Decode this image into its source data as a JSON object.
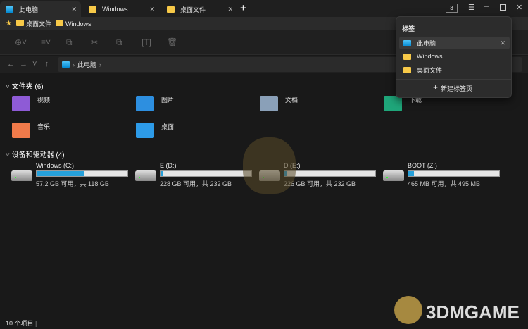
{
  "tabs": [
    {
      "label": "此电脑",
      "icon": "monitor-icon"
    },
    {
      "label": "Windows",
      "icon": "folder-icon"
    },
    {
      "label": "桌面文件",
      "icon": "folder-icon"
    }
  ],
  "window": {
    "tab_count": "3"
  },
  "bookmarks": [
    "桌面文件",
    "Windows"
  ],
  "address": {
    "path": "此电脑"
  },
  "folders_header": "文件夹 (6)",
  "folders": [
    {
      "label": "视频",
      "color": "#8e5bd6"
    },
    {
      "label": "图片",
      "color": "#2d8fe0"
    },
    {
      "label": "文档",
      "color": "#8aa0b8"
    },
    {
      "label": "下载",
      "color": "#1fa67a"
    },
    {
      "label": "音乐",
      "color": "#f07a4a"
    },
    {
      "label": "桌面",
      "color": "#2d9be8"
    }
  ],
  "devices_header": "设备和驱动器 (4)",
  "drives": [
    {
      "name": "Windows (C:)",
      "size": "57.2 GB 可用，共 118 GB",
      "used": 0.52
    },
    {
      "name": "E (D:)",
      "size": "228 GB 可用，共 232 GB",
      "used": 0.02
    },
    {
      "name": "D (E:)",
      "size": "226 GB 可用，共 232 GB",
      "used": 0.03
    },
    {
      "name": "BOOT (Z:)",
      "size": "465 MB 可用，共 495 MB",
      "used": 0.06
    }
  ],
  "status": "10 个项目",
  "popup": {
    "title": "标签",
    "items": [
      "此电脑",
      "Windows",
      "桌面文件"
    ],
    "new_tab": "新建标签页"
  },
  "watermark": "3DMGAME"
}
